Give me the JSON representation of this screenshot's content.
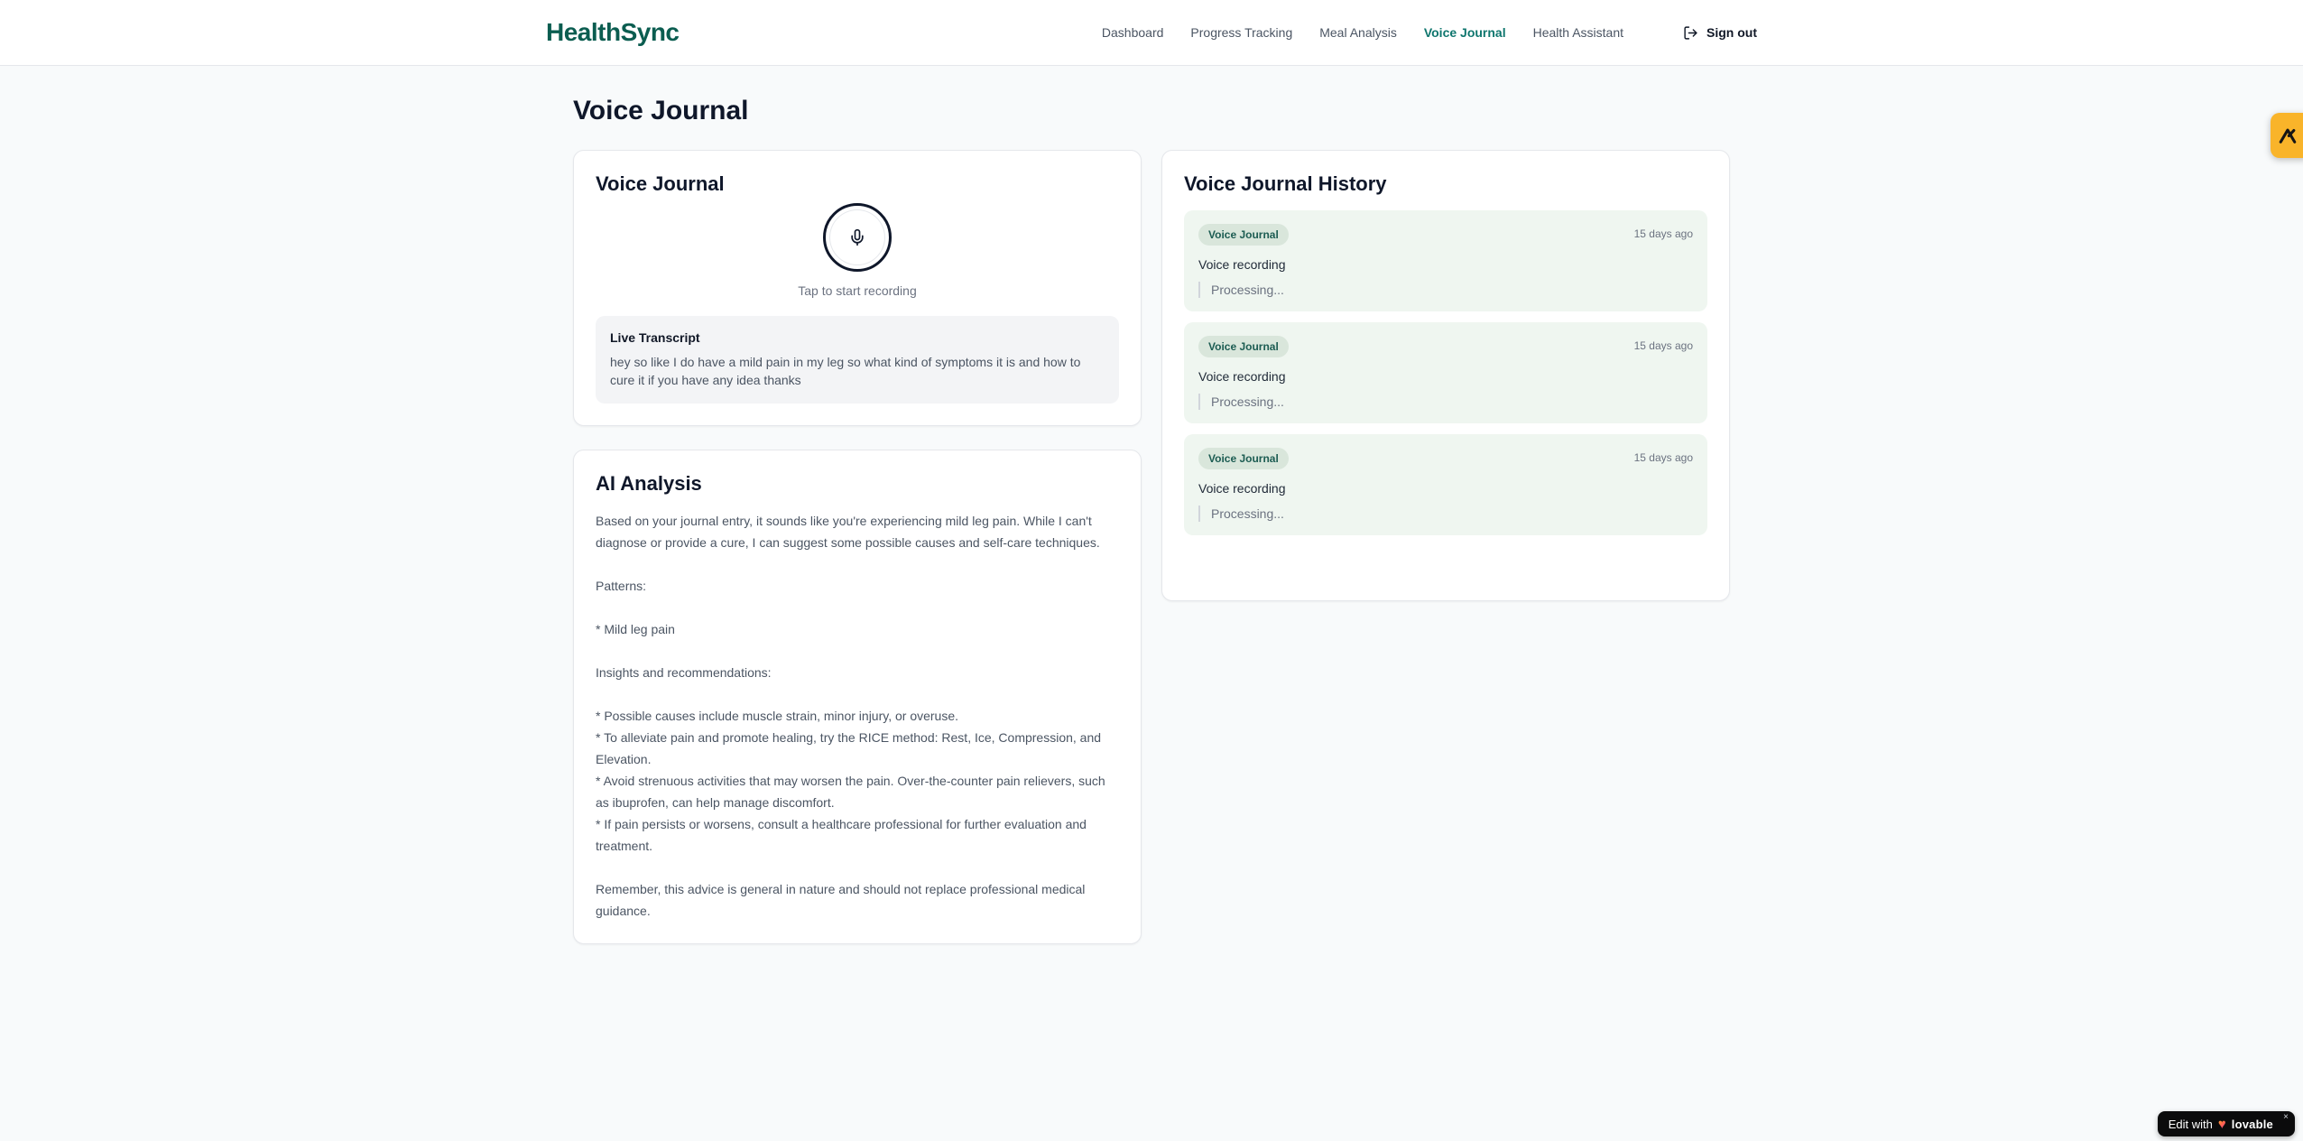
{
  "brand": {
    "name": "HealthSync"
  },
  "nav": {
    "items": [
      {
        "label": "Dashboard",
        "active": false
      },
      {
        "label": "Progress Tracking",
        "active": false
      },
      {
        "label": "Meal Analysis",
        "active": false
      },
      {
        "label": "Voice Journal",
        "active": true
      },
      {
        "label": "Health Assistant",
        "active": false
      }
    ],
    "sign_out_label": "Sign out"
  },
  "page": {
    "title": "Voice Journal"
  },
  "recorder_card": {
    "title": "Voice Journal",
    "tap_hint": "Tap to start recording",
    "transcript_title": "Live Transcript",
    "transcript_text": "hey so like I do have a mild pain in my leg so what kind of symptoms it is and how to cure it if you have any idea thanks"
  },
  "analysis_card": {
    "title": "AI Analysis",
    "body": "Based on your journal entry, it sounds like you're experiencing mild leg pain. While I can't diagnose or provide a cure, I can suggest some possible causes and self-care techniques.\n\nPatterns:\n\n* Mild leg pain\n\nInsights and recommendations:\n\n* Possible causes include muscle strain, minor injury, or overuse.\n* To alleviate pain and promote healing, try the RICE method: Rest, Ice, Compression, and Elevation.\n* Avoid strenuous activities that may worsen the pain. Over-the-counter pain relievers, such as ibuprofen, can help manage discomfort.\n* If pain persists or worsens, consult a healthcare professional for further evaluation and treatment.\n\nRemember, this advice is general in nature and should not replace professional medical guidance."
  },
  "history_card": {
    "title": "Voice Journal History",
    "entries": [
      {
        "badge": "Voice Journal",
        "time": "15 days ago",
        "label": "Voice recording",
        "status": "Processing..."
      },
      {
        "badge": "Voice Journal",
        "time": "15 days ago",
        "label": "Voice recording",
        "status": "Processing..."
      },
      {
        "badge": "Voice Journal",
        "time": "15 days ago",
        "label": "Voice recording",
        "status": "Processing..."
      }
    ]
  },
  "floating": {
    "edit_prefix": "Edit with",
    "edit_brand": "lovable",
    "heart_glyph": "♥",
    "close_glyph": "×"
  },
  "colors": {
    "brand_teal": "#0b5d50",
    "nav_active_teal": "#0f766e",
    "badge_bg_green": "#d9e6db",
    "badge_text_green": "#1c5c52",
    "entry_bg_green": "#eff6f0",
    "corner_badge_amber": "#f9b42a",
    "pill_black": "#0b0b0c"
  }
}
